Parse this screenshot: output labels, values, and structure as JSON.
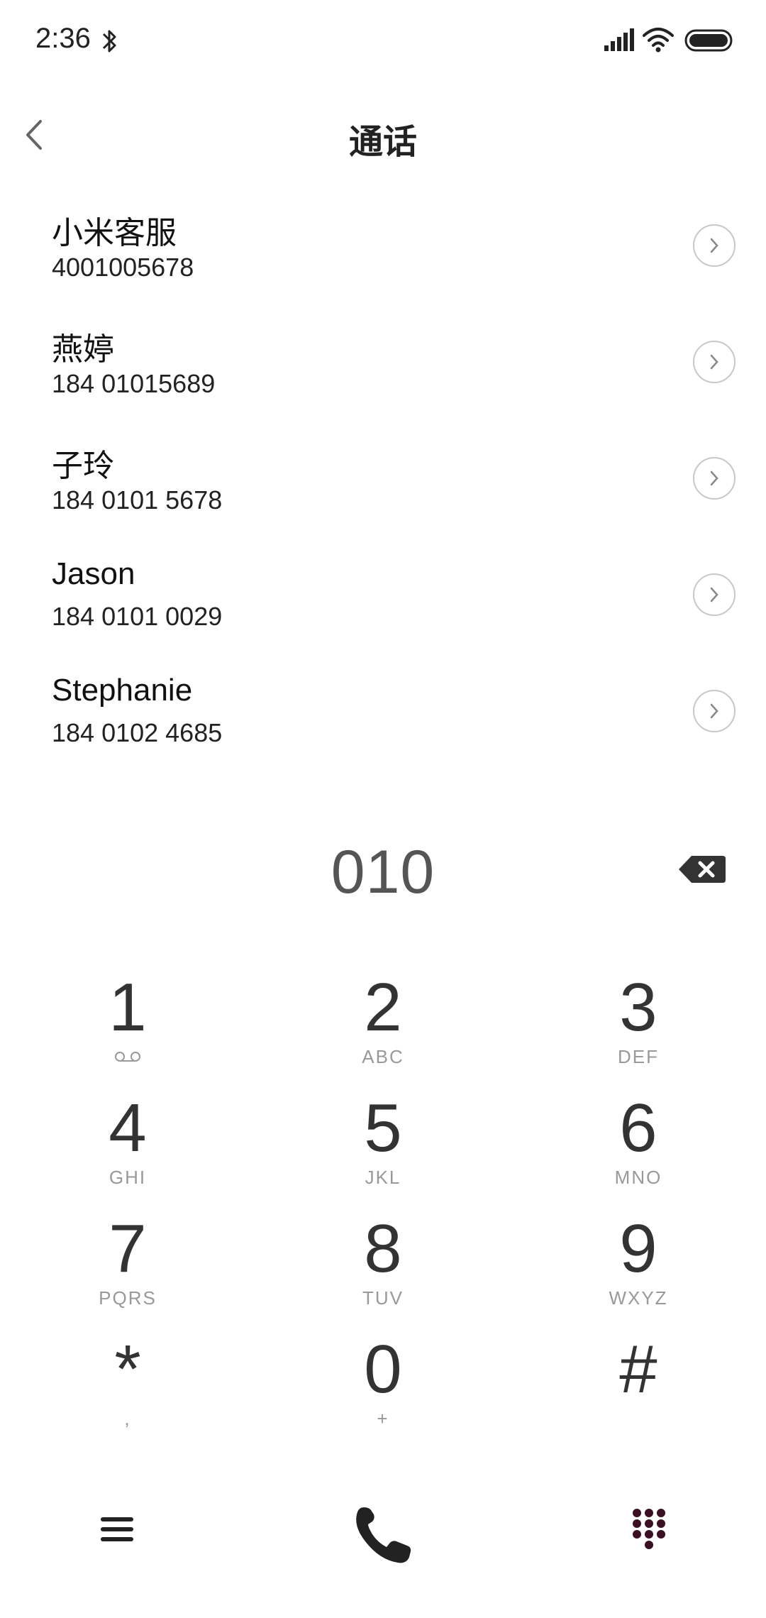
{
  "status_bar": {
    "time": "2:36"
  },
  "header": {
    "title": "通话",
    "back_icon": "chevron-left-icon"
  },
  "contacts": [
    {
      "name": "小米客服",
      "number": "4001005678"
    },
    {
      "name": "燕婷",
      "number": "184 01015689"
    },
    {
      "name": "子玲",
      "number": "184 0101 5678"
    },
    {
      "name": "Jason",
      "number": "184 0101 0029"
    },
    {
      "name": "Stephanie",
      "number": "184 0102 4685"
    }
  ],
  "dialer": {
    "input_value": "010"
  },
  "keypad": [
    {
      "digit": "1",
      "letters": ""
    },
    {
      "digit": "2",
      "letters": "ABC"
    },
    {
      "digit": "3",
      "letters": "DEF"
    },
    {
      "digit": "4",
      "letters": "GHI"
    },
    {
      "digit": "5",
      "letters": "JKL"
    },
    {
      "digit": "6",
      "letters": "MNO"
    },
    {
      "digit": "7",
      "letters": "PQRS"
    },
    {
      "digit": "8",
      "letters": "TUV"
    },
    {
      "digit": "9",
      "letters": "WXYZ"
    },
    {
      "digit": "*",
      "letters": ","
    },
    {
      "digit": "0",
      "letters": "+"
    },
    {
      "digit": "#",
      "letters": ""
    }
  ],
  "colors": {
    "call_icon": "#222222",
    "keypad_toggle_icon": "#3a0f24"
  }
}
